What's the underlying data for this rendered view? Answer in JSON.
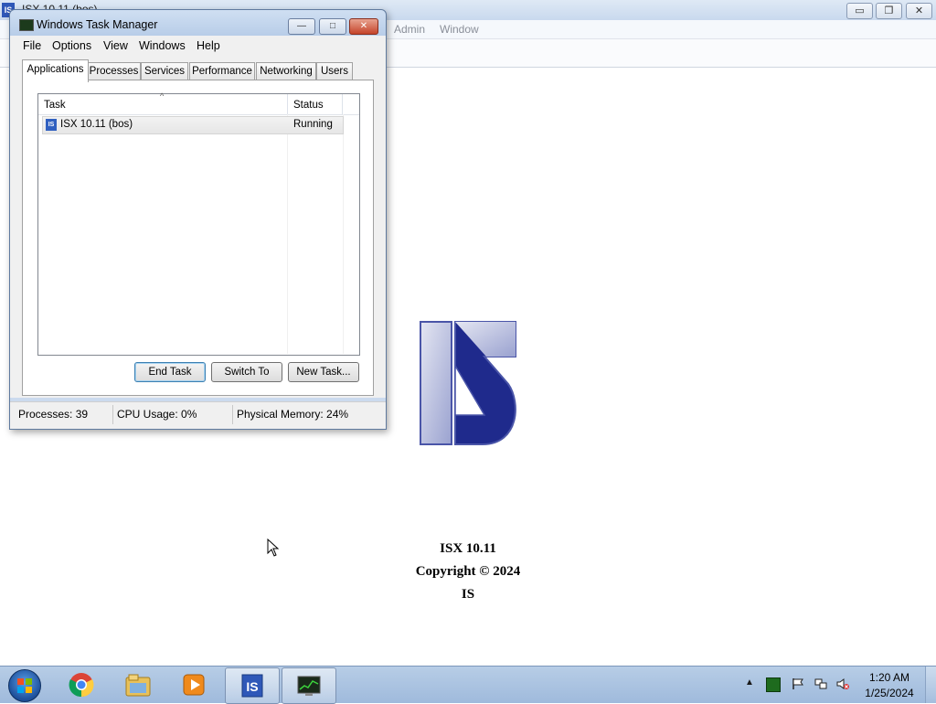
{
  "background_app": {
    "title": "ISX 10.11 (bos)",
    "menu": [
      "Admin",
      "Window"
    ],
    "window_buttons": {
      "minimize": "▭",
      "restore": "❐",
      "close": "✕"
    }
  },
  "splash": {
    "line1": "ISX 10.11",
    "line2": "Copyright © 2024",
    "line3": "IS",
    "logo_colors": {
      "dark": "#1f2a8c",
      "light": "#c9cde6",
      "edge": "#5a66b0"
    }
  },
  "task_manager": {
    "title": "Windows Task Manager",
    "window_buttons": {
      "minimize": "—",
      "maximize": "□",
      "close": "✕"
    },
    "menu": [
      "File",
      "Options",
      "View",
      "Windows",
      "Help"
    ],
    "tabs": [
      "Applications",
      "Processes",
      "Services",
      "Performance",
      "Networking",
      "Users"
    ],
    "active_tab": "Applications",
    "columns": {
      "task": "Task",
      "status": "Status",
      "sort_indicator": "^"
    },
    "rows": [
      {
        "icon": "IS",
        "task": "ISX 10.11 (bos)",
        "status": "Running"
      }
    ],
    "buttons": {
      "end_task": "End Task",
      "switch_to": "Switch To",
      "new_task": "New Task..."
    },
    "statusbar": {
      "processes": "Processes: 39",
      "cpu": "CPU Usage: 0%",
      "memory": "Physical Memory: 24%"
    }
  },
  "taskbar": {
    "items": [
      "chrome-icon",
      "file-explorer-icon",
      "media-player-icon",
      "isx-icon",
      "task-manager-icon"
    ],
    "tray_up": "▲",
    "clock": {
      "time": "1:20 AM",
      "date": "1/25/2024"
    }
  }
}
